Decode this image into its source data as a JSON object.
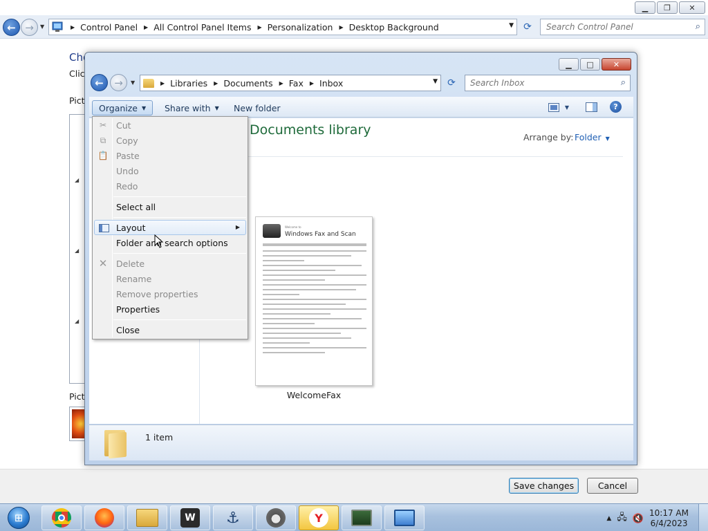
{
  "background_window": {
    "breadcrumbs": [
      "Control Panel",
      "All Control Panel Items",
      "Personalization",
      "Desktop Background"
    ],
    "search_placeholder": "Search Control Panel",
    "heading_fragment": "Cho",
    "sub_fragment": "Click",
    "picture_fragment_1": "Pictu",
    "picture_fragment_2": "Pictu",
    "save_button": "Save changes",
    "cancel_button": "Cancel"
  },
  "explorer": {
    "breadcrumbs": [
      "Libraries",
      "Documents",
      "Fax",
      "Inbox"
    ],
    "search_placeholder": "Search Inbox",
    "toolbar": {
      "organize": "Organize",
      "share_with": "Share with",
      "new_folder": "New folder"
    },
    "library_title": "Documents library",
    "arrange_label": "Arrange by:",
    "arrange_value": "Folder",
    "file": {
      "name": "WelcomeFax",
      "preview_title": "Windows Fax and Scan",
      "preview_welcome": "Welcome to"
    },
    "details": {
      "item_count": "1 item"
    }
  },
  "organize_menu": {
    "items": [
      {
        "label": "Cut",
        "enabled": false,
        "icon": "scissors-icon"
      },
      {
        "label": "Copy",
        "enabled": false,
        "icon": "copy-icon"
      },
      {
        "label": "Paste",
        "enabled": false,
        "icon": "paste-icon"
      },
      {
        "label": "Undo",
        "enabled": false
      },
      {
        "label": "Redo",
        "enabled": false
      },
      {
        "label": "Select all",
        "enabled": true
      },
      {
        "label": "Layout",
        "enabled": true,
        "icon": "layout-icon",
        "submenu": true,
        "highlighted": true
      },
      {
        "label": "Folder and search options",
        "enabled": true
      },
      {
        "label": "Delete",
        "enabled": false,
        "icon": "delete-x-icon"
      },
      {
        "label": "Rename",
        "enabled": false
      },
      {
        "label": "Remove properties",
        "enabled": false
      },
      {
        "label": "Properties",
        "enabled": true
      },
      {
        "label": "Close",
        "enabled": true
      }
    ]
  },
  "taskbar": {
    "apps": [
      "windows-explorer",
      "chrome",
      "firefox",
      "file-manager",
      "world-of-tanks",
      "world-of-warships",
      "raccoon-app",
      "yandex-browser",
      "network-monitor",
      "control-panel"
    ],
    "clock_time": "10:17 AM",
    "clock_date": "6/4/2023"
  },
  "colors": {
    "accent_blue": "#1f5fb4",
    "library_green": "#1e6a3a",
    "close_red": "#c7452f"
  }
}
